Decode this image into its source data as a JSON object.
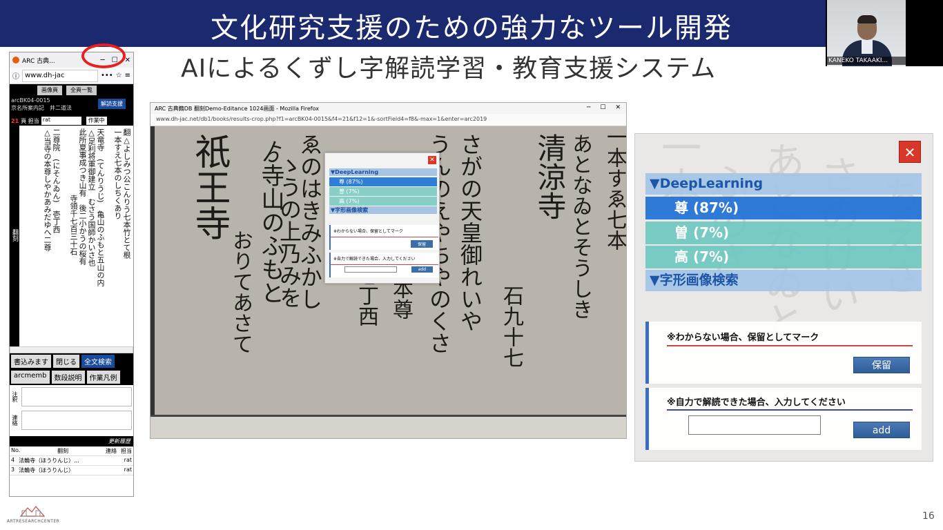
{
  "slide": {
    "title": "文化研究支援のための強力なツール開発",
    "subtitle": "AIによるくずし字解読学習・教育支援システム",
    "page_number": "16",
    "logo_text": "ARTRESEARCHCENTER"
  },
  "webcam": {
    "name": "KANEKO TAKAAKI..."
  },
  "left_browser": {
    "tab_title": "ARC 古典...",
    "url": "www.dh-jac",
    "url_icons": [
      "•••",
      "☆",
      "≡"
    ],
    "top_buttons": [
      "画像頁",
      "全頁一覧"
    ],
    "record_id": "arcBK04-0015",
    "source_line": "京名所案内記　井二道法",
    "help_button": "解読支援",
    "row_num": "21",
    "row_label": "頁 担当",
    "row_value": "rat",
    "status": "作業中",
    "vertical_lines": [
      "翻△よしみつ公こんりう七本竹とて根",
      "一本すえ七本のしちくあり",
      "天竜寺　(てんりうじ)　亀山のふもと五山の内",
      "△足利将軍御建立　むさう国師かいさ也",
      "此所夏事成つき山有　後二小かうの桜有",
      "寺領千七百三十石",
      "二尊院　(にそんゐん)　壱丁西",
      "△当寺の本尊しやかあみだゆへ二尊"
    ],
    "side_label": "翻刻",
    "buttons": [
      "書込みます",
      "閉じる",
      "全文検索"
    ],
    "member_field": "arcmemb",
    "member_buttons": [
      "数段説明",
      "作業凡例"
    ],
    "note_label": "注釈",
    "contact_label": "連絡",
    "history_header": "更新履歴",
    "history_cols": [
      "No.",
      "翻刻",
      "連絡",
      "担当"
    ],
    "history_rows": [
      {
        "no": "4",
        "text": "法輪寺（ほうりんじ）...",
        "who": "rat"
      },
      {
        "no": "3",
        "text": "法輪寺（ほうりんじ）",
        "who": "rat"
      }
    ]
  },
  "middle_browser": {
    "window_title": "ARC 古典籍DB 翻刻Demo-Editance 1024画面 - Mozilla Firefox",
    "url": "www.dh-jac.net/db1/books/results-crop.php?f1=arcBK04-0015&f4=21&f12=1&-sortField4=f8&-max=1&enter=arc2019",
    "popup": {
      "deeplearning_head": "▼DeepLearning",
      "candidates": [
        "尊 (87%)",
        "曽 (7%)",
        "高 (7%)"
      ],
      "image_search_head": "▼字形画像検索",
      "mark_label": "※わからない場合、保留としてマーク",
      "mark_button": "保留",
      "input_label": "※自力で解読できた場合、入力してください",
      "add_button": "add"
    }
  },
  "right_panel": {
    "close": "✕",
    "deeplearning_head": "▼DeepLearning",
    "candidates": [
      "尊 (87%)",
      "曽 (7%)",
      "高 (7%)"
    ],
    "image_search_head": "▼字形画像検索",
    "mark_label": "※わからない場合、保留としてマーク",
    "mark_button": "保留",
    "input_label": "※自力で解読できた場合、入力してください",
    "input_value": "",
    "add_button": "add"
  },
  "colors": {
    "title_band": "#1b2a6e",
    "deeplearning_blue": "#1d56a8",
    "selected_candidate": "#2574d6",
    "candidate_teal": "#6ec8c0",
    "close_red": "#d9372a",
    "highlight_circle": "#e82020"
  }
}
